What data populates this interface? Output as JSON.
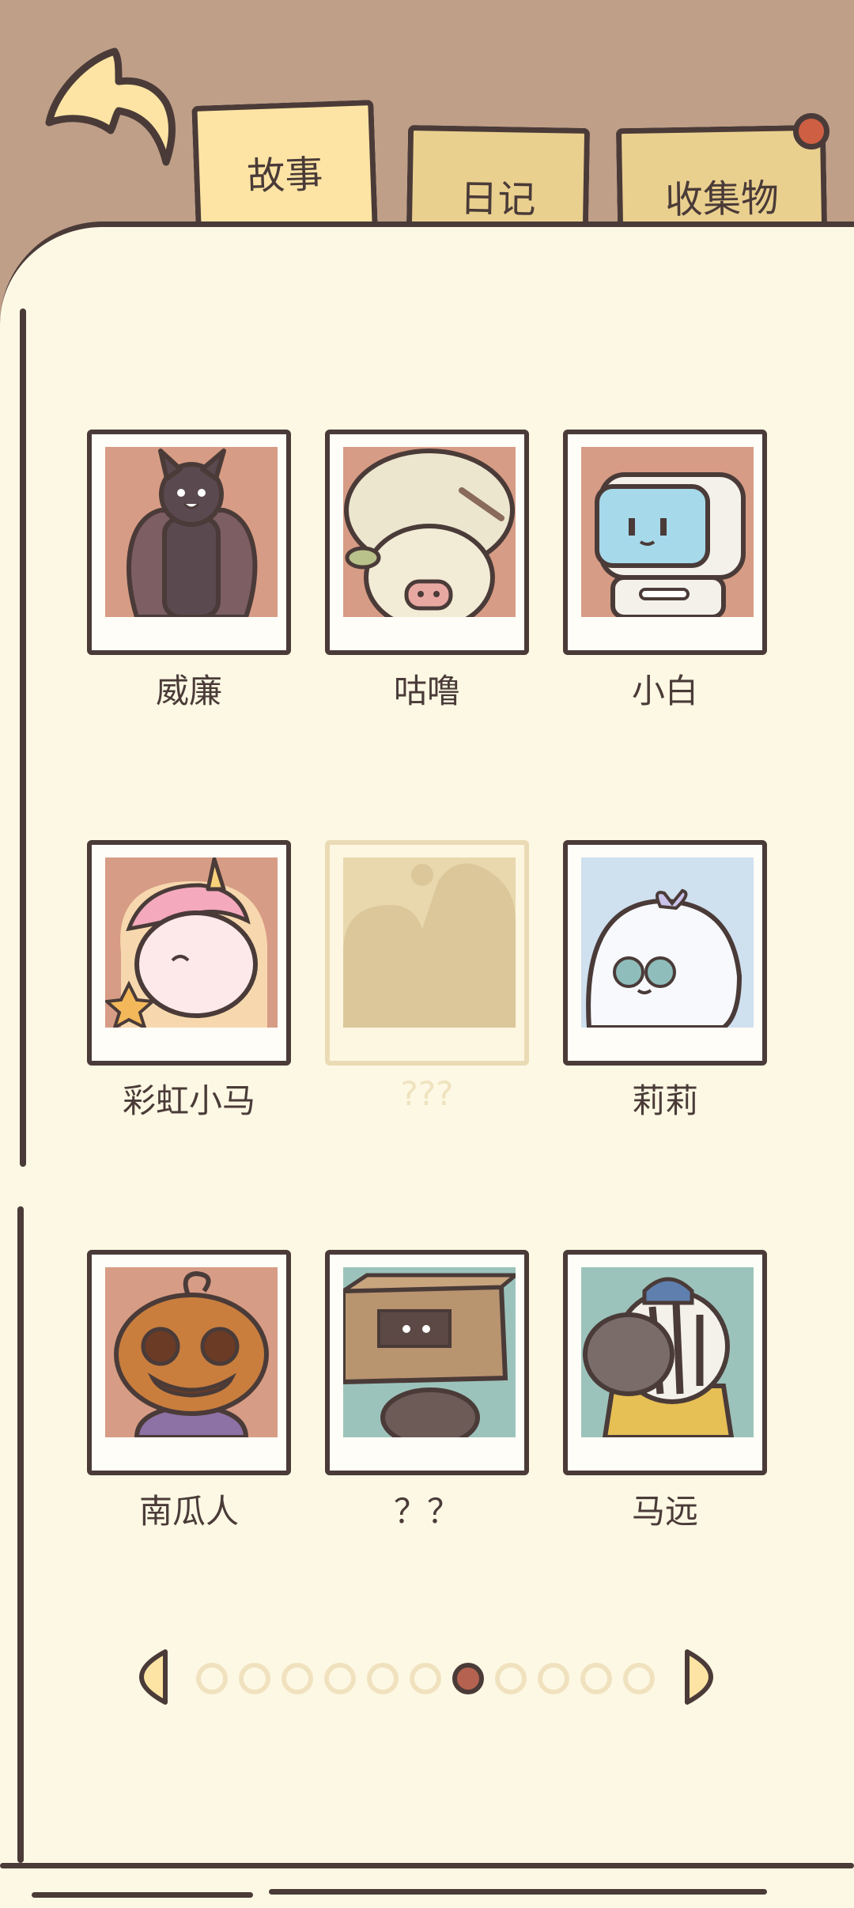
{
  "tabs": [
    {
      "label": "故事",
      "active": true
    },
    {
      "label": "日记",
      "active": false
    },
    {
      "label": "收集物",
      "active": false,
      "has_notification": true
    }
  ],
  "characters": [
    {
      "name": "威廉",
      "locked": false,
      "icon": "bat-character",
      "bg": "#d79c85"
    },
    {
      "name": "咕噜",
      "locked": false,
      "icon": "sheep-character",
      "bg": "#d79c85"
    },
    {
      "name": "小白",
      "locked": false,
      "icon": "robot-character",
      "bg": "#d79c85"
    },
    {
      "name": "彩虹小马",
      "locked": false,
      "icon": "unicorn-character",
      "bg": "#d79c85"
    },
    {
      "name": "???",
      "locked": true,
      "icon": "locked-silhouette",
      "bg": "#e9d8ae"
    },
    {
      "name": "莉莉",
      "locked": false,
      "icon": "ghost-character",
      "bg": "#cfe0ef"
    },
    {
      "name": "南瓜人",
      "locked": false,
      "icon": "pumpkin-character",
      "bg": "#d79c85"
    },
    {
      "name": "？？",
      "locked": false,
      "icon": "box-character",
      "bg": "#9cc3bb"
    },
    {
      "name": "马远",
      "locked": false,
      "icon": "zebra-character",
      "bg": "#9cc3bb"
    }
  ],
  "pagination": {
    "total_pages": 11,
    "current_page": 7
  },
  "colors": {
    "ink": "#4a3b38",
    "paper": "#fdf8e4",
    "header": "#bf9f88",
    "tab_active": "#fde4a4",
    "tab_inactive": "#ead08f",
    "accent": "#cf5f43"
  }
}
